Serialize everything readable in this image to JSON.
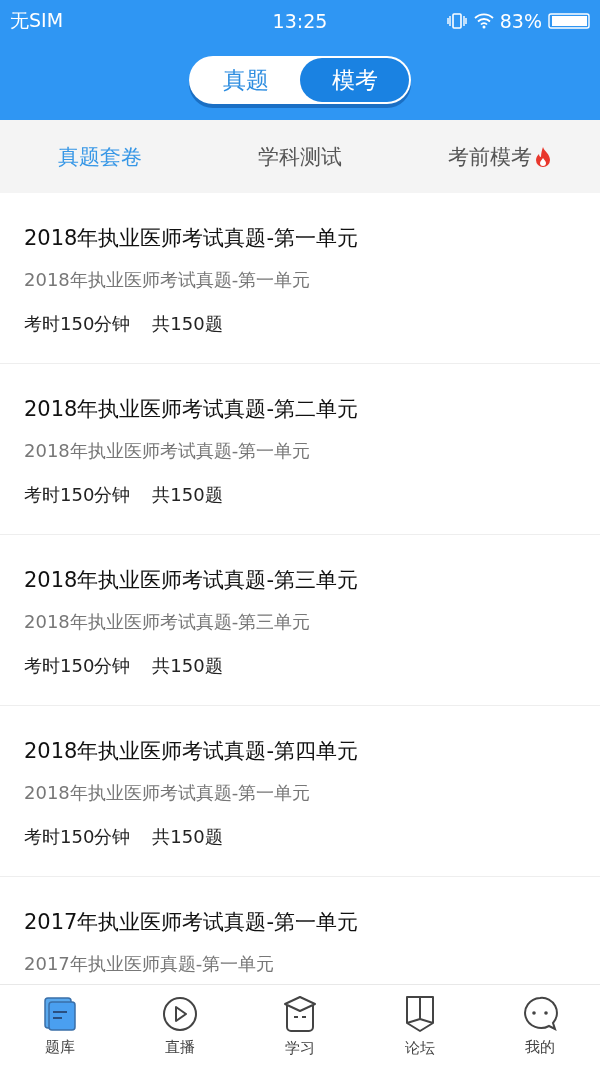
{
  "status_bar": {
    "carrier": "无SIM",
    "time": "13:25",
    "battery": "83%"
  },
  "segments": [
    {
      "label": "真题",
      "selected": false
    },
    {
      "label": "模考",
      "selected": true
    }
  ],
  "tabs": [
    {
      "label": "真题套卷",
      "selected": true,
      "hot": false
    },
    {
      "label": "学科测试",
      "selected": false,
      "hot": false
    },
    {
      "label": "考前模考",
      "selected": false,
      "hot": true
    }
  ],
  "papers": [
    {
      "title": "2018年执业医师考试真题-第一单元",
      "subtitle": "2018年执业医师考试真题-第一单元",
      "duration": "考时150分钟",
      "count": "共150题"
    },
    {
      "title": "2018年执业医师考试真题-第二单元",
      "subtitle": "2018年执业医师考试真题-第一单元",
      "duration": "考时150分钟",
      "count": "共150题"
    },
    {
      "title": "2018年执业医师考试真题-第三单元",
      "subtitle": "2018年执业医师考试真题-第三单元",
      "duration": "考时150分钟",
      "count": "共150题"
    },
    {
      "title": "2018年执业医师考试真题-第四单元",
      "subtitle": "2018年执业医师考试真题-第一单元",
      "duration": "考时150分钟",
      "count": "共150题"
    },
    {
      "title": "2017年执业医师考试真题-第一单元",
      "subtitle": "2017年执业医师真题-第一单元"
    }
  ],
  "nav": [
    {
      "label": "题库",
      "kind": "bank",
      "selected": true
    },
    {
      "label": "直播",
      "kind": "live",
      "selected": false
    },
    {
      "label": "学习",
      "kind": "study",
      "selected": false
    },
    {
      "label": "论坛",
      "kind": "forum",
      "selected": false
    },
    {
      "label": "我的",
      "kind": "me",
      "selected": false
    }
  ]
}
